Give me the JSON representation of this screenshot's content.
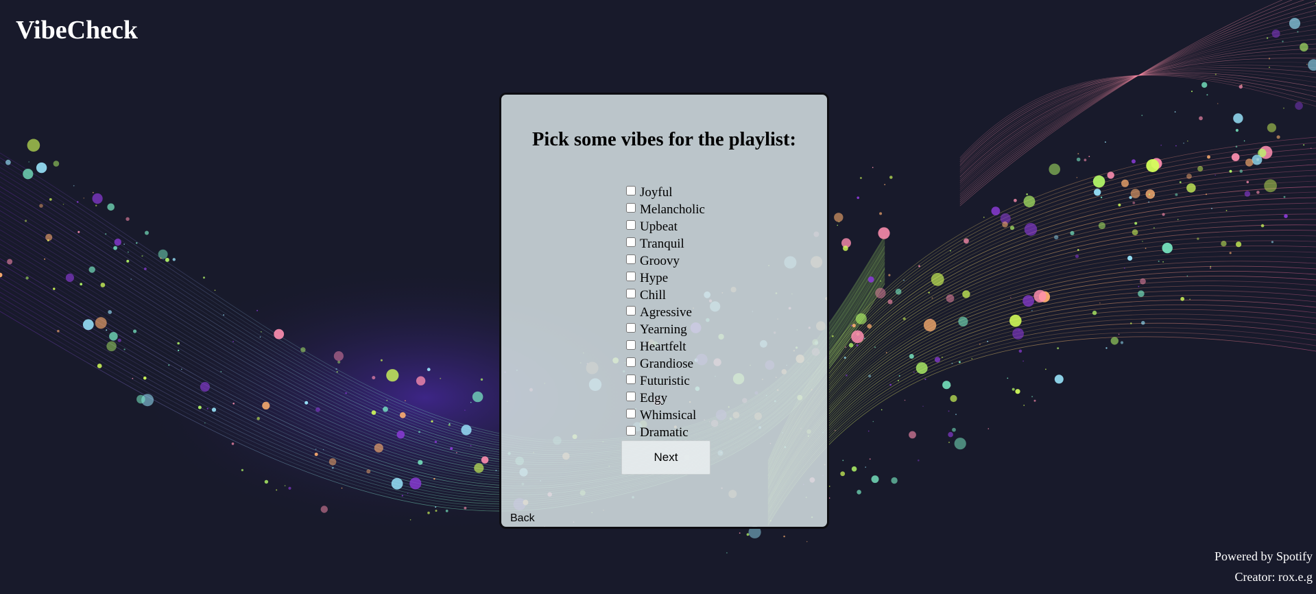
{
  "header": {
    "brand": "VibeCheck"
  },
  "card": {
    "title": "Pick some vibes for the playlist:",
    "vibes": [
      {
        "label": "Joyful",
        "checked": false
      },
      {
        "label": "Melancholic",
        "checked": false
      },
      {
        "label": "Upbeat",
        "checked": false
      },
      {
        "label": "Tranquil",
        "checked": false
      },
      {
        "label": "Groovy",
        "checked": false
      },
      {
        "label": "Hype",
        "checked": false
      },
      {
        "label": "Chill",
        "checked": false
      },
      {
        "label": "Agressive",
        "checked": false
      },
      {
        "label": "Yearning",
        "checked": false
      },
      {
        "label": "Heartfelt",
        "checked": false
      },
      {
        "label": "Grandiose",
        "checked": false
      },
      {
        "label": "Futuristic",
        "checked": false
      },
      {
        "label": "Edgy",
        "checked": false
      },
      {
        "label": "Whimsical",
        "checked": false
      },
      {
        "label": "Dramatic",
        "checked": false
      }
    ],
    "next_label": "Next",
    "back_label": "Back"
  },
  "footer": {
    "powered_by": "Powered by Spotify",
    "creator": "Creator: rox.e.g"
  },
  "colors": {
    "page_background": "#181a2b",
    "card_background": "#d6e2e4",
    "text_light": "#ffffff",
    "text_dark": "#000000"
  },
  "icons": {
    "background": "particle-swirl-background"
  }
}
